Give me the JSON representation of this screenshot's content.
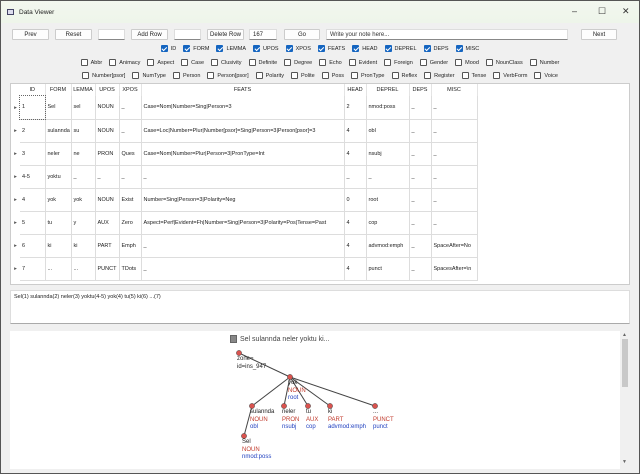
{
  "window": {
    "title": "Data Viewer",
    "minimize": "–",
    "maximize": "☐",
    "close": "✕"
  },
  "toolbar": {
    "prev": "Prev",
    "reset": "Reset",
    "add_row": "Add Row",
    "delete_row": "Delete Row",
    "sentence_number": "167",
    "go": "Go",
    "note_placeholder": "Write your note here...",
    "next": "Next"
  },
  "columns_checks": [
    "ID",
    "FORM",
    "LEMMA",
    "UPOS",
    "XPOS",
    "FEATS",
    "HEAD",
    "DEPREL",
    "DEPS",
    "MISC"
  ],
  "feat_checks_1": [
    "Abbr",
    "Animacy",
    "Aspect",
    "Case",
    "Clusivity",
    "Definite",
    "Degree",
    "Echo",
    "Evident",
    "Foreign",
    "Gender",
    "Mood",
    "NounClass",
    "Number"
  ],
  "feat_checks_2": [
    "Number[psor]",
    "NumType",
    "Person",
    "Person[psor]",
    "Polarity",
    "Polite",
    "Poss",
    "PronType",
    "Reflex",
    "Register",
    "Tense",
    "VerbForm",
    "Voice"
  ],
  "table": {
    "headers": [
      "ID",
      "FORM",
      "LEMMA",
      "UPOS",
      "XPOS",
      "FEATS",
      "HEAD",
      "DEPREL",
      "DEPS",
      "MISC"
    ],
    "rows": [
      [
        "1",
        "Sel",
        "sel",
        "NOUN",
        "_",
        "Case=Nom|Number=Sing|Person=3",
        "2",
        "nmod:poss",
        "_",
        "_"
      ],
      [
        "2",
        "sulannda",
        "su",
        "NOUN",
        "_",
        "Case=Loc|Number=Plur|Number[psor]=Sing|Person=3|Person[psor]=3",
        "4",
        "obl",
        "_",
        "_"
      ],
      [
        "3",
        "neler",
        "ne",
        "PRON",
        "Ques",
        "Case=Nom|Number=Plur|Person=3|PronType=Int",
        "4",
        "nsubj",
        "_",
        "_"
      ],
      [
        "4-5",
        "yoktu",
        "_",
        "_",
        "_",
        "_",
        "_",
        "_",
        "_",
        "_"
      ],
      [
        "4",
        "yok",
        "yok",
        "NOUN",
        "Exist",
        "Number=Sing|Person=3|Polarity=Neg",
        "0",
        "root",
        "_",
        "_"
      ],
      [
        "5",
        "tu",
        "y",
        "AUX",
        "Zero",
        "Aspect=Perf|Evident=Fh|Number=Sing|Person=3|Polarity=Pos|Tense=Past",
        "4",
        "cop",
        "_",
        "_"
      ],
      [
        "6",
        "ki",
        "ki",
        "PART",
        "Emph",
        "_",
        "4",
        "advmod:emph",
        "_",
        "SpaceAfter=No"
      ],
      [
        "7",
        "...",
        "...",
        "PUNCT",
        "TDots",
        "_",
        "4",
        "punct",
        "_",
        "SpacesAfter=\\n"
      ]
    ]
  },
  "sentence_text": "Sel(1) sulannda(2) neler(3) yoktu(4-5) yok(4) tu(5) ki(6) ...(7)",
  "tree": {
    "title": "Sel sulannda neler yoktu ki...",
    "root_label_1": "zone=",
    "root_label_2": "id=ins_947",
    "nodes": [
      {
        "form": "yok",
        "upos": "NOUN",
        "deprel": "root"
      },
      {
        "form": "sulannda",
        "upos": "NOUN",
        "deprel": "obl"
      },
      {
        "form": "neler",
        "upos": "PRON",
        "deprel": "nsubj"
      },
      {
        "form": "tu",
        "upos": "AUX",
        "deprel": "cop"
      },
      {
        "form": "ki",
        "upos": "PART",
        "deprel": "advmod:emph"
      },
      {
        "form": "...",
        "upos": "PUNCT",
        "deprel": "punct"
      },
      {
        "form": "Sel",
        "upos": "NOUN",
        "deprel": "nmod:poss"
      }
    ]
  },
  "colors": {
    "accent": "#1565c0",
    "node": "#d9534f",
    "upos": "#c0392b",
    "deprel": "#1f3fbf"
  }
}
